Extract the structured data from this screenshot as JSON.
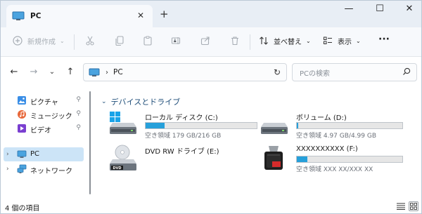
{
  "window": {
    "tab_title": "PC",
    "tab_icon": "pc-icon",
    "close_glyph": "✕",
    "new_tab_glyph": "+",
    "minimize_glyph": "—",
    "maximize_glyph": "☐",
    "close_window_glyph": "✕"
  },
  "toolbar": {
    "new_label": "新規作成",
    "sort_label": "並べ替え",
    "view_label": "表示",
    "more_label": "···"
  },
  "address": {
    "crumb_sep": "›",
    "location": "PC",
    "search_placeholder": "PCの検索"
  },
  "sidebar": {
    "items": [
      {
        "label": "ピクチャ",
        "icon": "pictures-icon",
        "pinned": true
      },
      {
        "label": "ミュージック",
        "icon": "music-icon",
        "pinned": true
      },
      {
        "label": "ビデオ",
        "icon": "video-icon",
        "pinned": true
      },
      {
        "label": "PC",
        "icon": "pc-icon",
        "selected": true
      },
      {
        "label": "ネットワーク",
        "icon": "network-icon"
      }
    ],
    "pin_glyph": "📌",
    "expander_glyph": "›"
  },
  "main": {
    "group_title": "デバイスとドライブ",
    "drives": [
      {
        "name": "ローカル ディスク (C:)",
        "free": "空き領域 179 GB/216 GB",
        "usage": 0.17,
        "icon": "windows-drive-icon"
      },
      {
        "name": "ボリューム (D:)",
        "free": "空き領域 4.97 GB/4.99 GB",
        "usage": 0.01,
        "icon": "hard-drive-icon"
      },
      {
        "name": "DVD RW ドライブ (E:)",
        "icon": "dvd-drive-icon"
      },
      {
        "name": "XXXXXXXXXX (F:)",
        "free": "空き領域 XXX XX/XXX XX",
        "usage": 0.1,
        "icon": "usb-drive-icon"
      }
    ]
  },
  "status": {
    "item_count": "4 個の項目"
  },
  "colors": {
    "accent": "#26a0da",
    "selection": "#cce4f7",
    "group_header": "#1f4e79"
  }
}
